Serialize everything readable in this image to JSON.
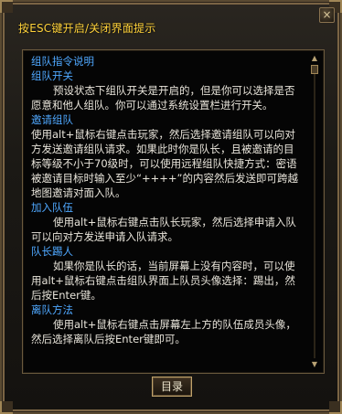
{
  "window": {
    "title": "按ESC键开启/关闭界面提示",
    "close_label": "×"
  },
  "content": {
    "heading_main": "组队指令说明",
    "sections": [
      {
        "heading": "组队开关",
        "text": "预设状态下组队开关是开启的，但是你可以选择是否愿意和他人组队。你可以通过系统设置栏进行开关。"
      },
      {
        "heading": "邀请组队",
        "text": "使用alt+鼠标右键点击玩家，然后选择邀请组队可以向对方发送邀请组队请求。如果此时你是队长，且被邀请的目标等级不小于70级时，可以使用远程组队快捷方式：密语被邀请目标时输入至少“++++”的内容然后发送即可跨越地图邀请对面入队。"
      },
      {
        "heading": "加入队伍",
        "text": "使用alt+鼠标右键点击队长玩家，然后选择申请入队可以向对方发送申请入队请求。"
      },
      {
        "heading": "队长踢人",
        "text": "如果你是队长的话，当前屏幕上没有内容时，可以使用alt+鼠标右键点击组队界面上队员头像选择：踢出，然后按Enter键。"
      },
      {
        "heading": "离队方法",
        "text": "使用alt+鼠标右键点击屏幕左上方的队伍成员头像，然后选择离队后按Enter键即可。"
      }
    ]
  },
  "footer": {
    "toc_label": "目录"
  },
  "scroll": {
    "up_icon": "▲",
    "down_icon": "▼"
  },
  "colors": {
    "title": "#ffd23a",
    "heading": "#4fa8ff",
    "body_text": "#e8e4da"
  }
}
